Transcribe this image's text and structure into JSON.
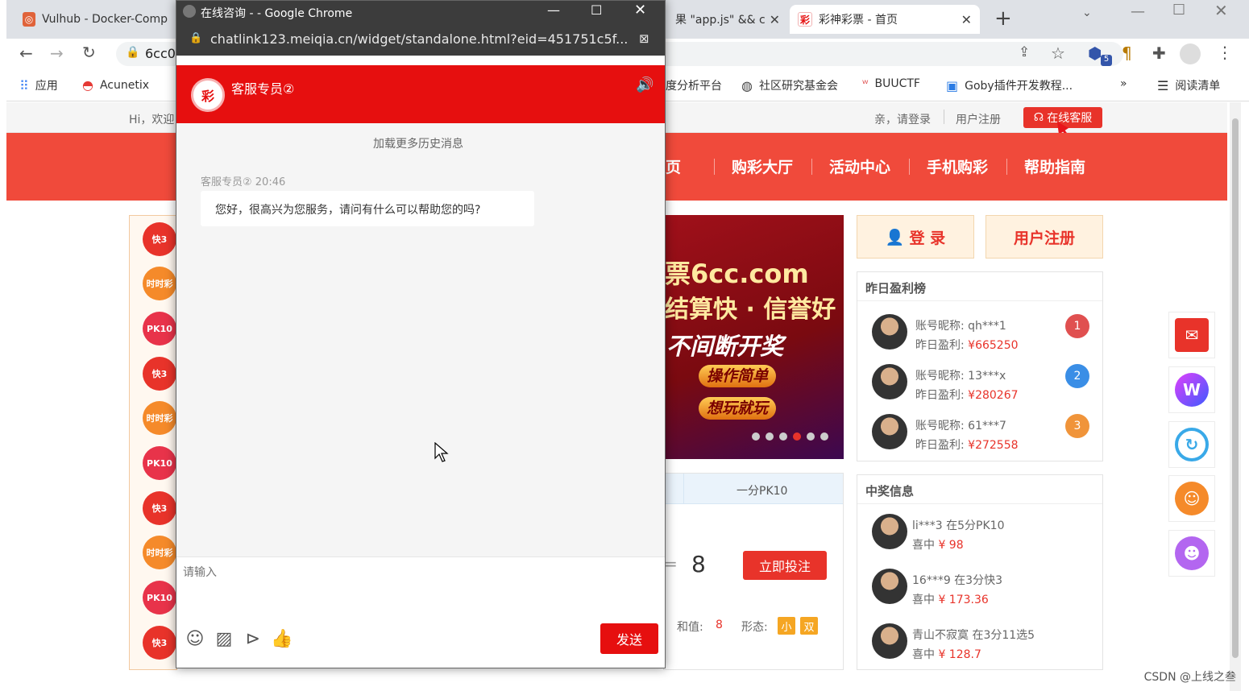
{
  "browser": {
    "tabs": [
      {
        "label": "Vulhub - Docker-Comp"
      },
      {
        "label": "果 \"app.js\" && c"
      },
      {
        "label": "彩神彩票 - 首页"
      }
    ],
    "new_tab": "+",
    "address_partial": "6cc0",
    "bookmarks": [
      {
        "label": "应用"
      },
      {
        "label": "Acunetix"
      },
      {
        "label": "度分析平台"
      },
      {
        "label": "社区研究基金会"
      },
      {
        "label": "BUUCTF"
      },
      {
        "label": "Goby插件开发教程..."
      },
      {
        "label": "阅读清单"
      }
    ],
    "bookmarks_more": "»",
    "ext_badge": "5"
  },
  "site": {
    "topbar": {
      "greeting": "Hi，欢迎",
      "login_prompt": "亲，请登录",
      "register": "用户注册",
      "service": "在线客服"
    },
    "nav": [
      "页",
      "购彩大厅",
      "活动中心",
      "手机购彩",
      "帮助指南"
    ],
    "left_icons": [
      "快3",
      "时时彩",
      "PK10",
      "快3",
      "时时彩",
      "PK10",
      "快3",
      "时时彩",
      "PK10",
      "快3"
    ],
    "banner": {
      "line1": "票6cc.com",
      "line2": "结算快 · 信誉好",
      "line3": "不间断开奖",
      "pill1": "操作简单",
      "pill2": "想玩就玩",
      "dots": 6,
      "active_dot": 4
    },
    "game": {
      "tab": "一分PK10",
      "number": "8",
      "bet_button": "立即投注",
      "sum_label": "和值:",
      "sum_value": "8",
      "shape_label": "形态:",
      "chip1": "小",
      "chip2": "双",
      "eq": "="
    },
    "auth": {
      "login": "登 录",
      "register": "用户注册"
    },
    "profit_board": {
      "title": "昨日盈利榜",
      "rows": [
        {
          "name_label": "账号昵称: ",
          "name": "qh***1",
          "profit_label": "昨日盈利: ",
          "profit": "¥665250",
          "rank": "1",
          "rank_color": "#e05050"
        },
        {
          "name_label": "账号昵称: ",
          "name": "13***x",
          "profit_label": "昨日盈利: ",
          "profit": "¥280267",
          "rank": "2",
          "rank_color": "#3a8ee6"
        },
        {
          "name_label": "账号昵称: ",
          "name": "61***7",
          "profit_label": "昨日盈利: ",
          "profit": "¥272558",
          "rank": "3",
          "rank_color": "#f0943a"
        }
      ]
    },
    "winners": {
      "title": "中奖信息",
      "rows": [
        {
          "line1": "li***3 在5分PK10",
          "line2_label": "喜中 ",
          "amount": "¥ 98"
        },
        {
          "line1": "16***9 在3分快3",
          "line2_label": "喜中 ",
          "amount": "¥ 173.36"
        },
        {
          "line1": "青山不寂寞 在3分11选5",
          "line2_label": "喜中 ",
          "amount": "¥ 128.7"
        }
      ]
    },
    "side_icons": [
      "red-envelope-icon",
      "w-logo-icon",
      "refresh-icon",
      "customer-service-icon",
      "smile-icon"
    ]
  },
  "popup": {
    "title": "在线咨询 - - Google Chrome",
    "url": "chatlink123.meiqia.cn/widget/standalone.html?eid=451751c5f...",
    "header_title": "客服专员②",
    "load_more": "加载更多历史消息",
    "message": {
      "sender": "客服专员② 20:46",
      "text": "您好，很高兴为您服务，请问有什么可以帮助您的吗?"
    },
    "input_placeholder": "请输入",
    "send": "发送"
  },
  "watermark": "CSDN @上线之叁",
  "colors": {
    "brand_red": "#e60f0f",
    "nav_red": "#f04a3b",
    "accent_orange": "#f5a623"
  }
}
